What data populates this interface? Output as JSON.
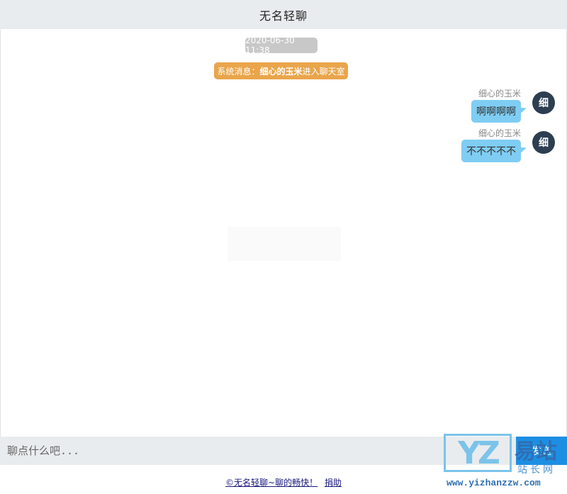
{
  "header": {
    "title": "无名轻聊"
  },
  "chat": {
    "timestamp": "2020-06-30 11:38",
    "system_message": {
      "label": "系统消息：",
      "user": "细心的玉米",
      "text": "进入聊天室"
    },
    "messages": [
      {
        "sender": "细心的玉米",
        "text": "啊啊啊啊",
        "avatar": "细"
      },
      {
        "sender": "细心的玉米",
        "text": "不不不不不",
        "avatar": "细"
      }
    ]
  },
  "input": {
    "placeholder": "聊点什么吧...",
    "send_label": "发送"
  },
  "footer": {
    "copyright_link": "©无名轻聊~聊的畅快！",
    "donate_link": "捐助"
  },
  "watermark": {
    "logo": "YZ",
    "brand": "易站",
    "sub": "站长网",
    "url": "www.yizhanzzw.com"
  },
  "colors": {
    "bubble": "#7fcdf3",
    "system_badge": "#e9a54b",
    "time_badge": "#c8c8c8",
    "avatar": "#2c3e50",
    "send_button": "#1d8fe3"
  }
}
